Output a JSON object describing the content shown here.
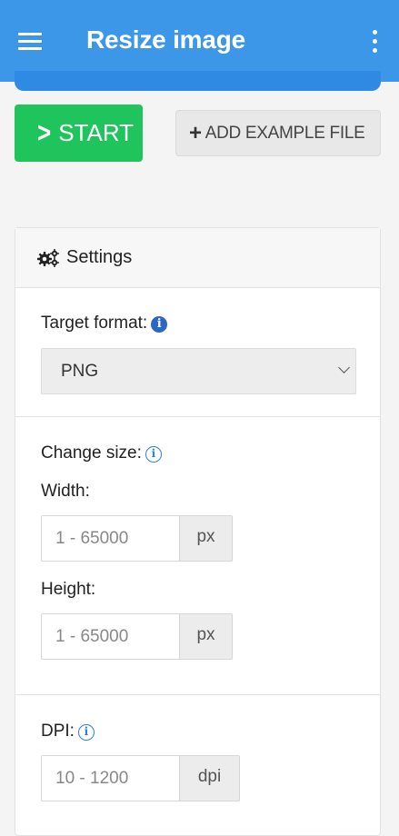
{
  "appbar": {
    "title": "Resize image",
    "menu_icon": "hamburger-menu-icon",
    "more_icon": "more-vertical-icon",
    "color": "#3d97e8"
  },
  "actions": {
    "start_label": "START",
    "start_icon": "chevron-right-icon",
    "start_color": "#1fc45c",
    "example_label": "ADD EXAMPLE FILE",
    "example_icon": "plus-icon"
  },
  "settings": {
    "header": "Settings",
    "header_icon": "gears-icon",
    "target_format": {
      "label": "Target format:",
      "info_icon": "info-circle-icon",
      "selected": "PNG"
    },
    "change_size": {
      "label": "Change size:",
      "info_icon": "info-circle-outline-icon",
      "width": {
        "label": "Width:",
        "placeholder": "1 - 65000",
        "unit": "px"
      },
      "height": {
        "label": "Height:",
        "placeholder": "1 - 65000",
        "unit": "px"
      }
    },
    "dpi": {
      "label": "DPI:",
      "info_icon": "info-circle-outline-icon",
      "placeholder": "10 - 1200",
      "unit": "dpi"
    }
  }
}
